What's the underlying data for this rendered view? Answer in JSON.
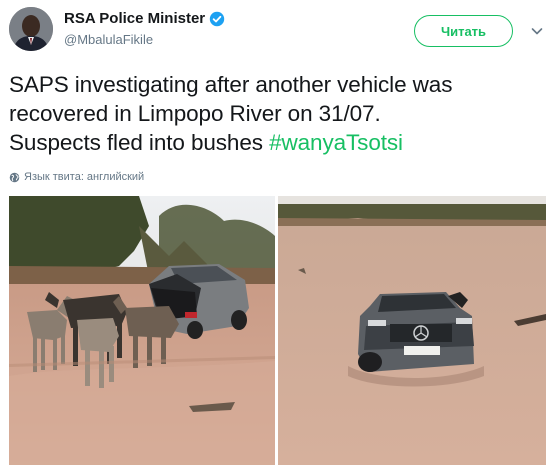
{
  "header": {
    "display_name": "RSA Police Minister",
    "handle": "@MbalulaFikile",
    "follow_label": "Читать"
  },
  "tweet": {
    "line1": "SAPS investigating after another vehicle was",
    "line2": "recovered in Limpopo River on 31/07.",
    "line3_prefix": "Suspects fled into bushes ",
    "hashtag": "#wanyaTsotsi"
  },
  "language_note": "Язык твита: английский",
  "photos": {
    "left_plate": "",
    "right_plate": "CA 0 00-00"
  },
  "colors": {
    "accent": "#17bf63",
    "verified": "#1da1f2",
    "secondary_text": "#657786"
  }
}
